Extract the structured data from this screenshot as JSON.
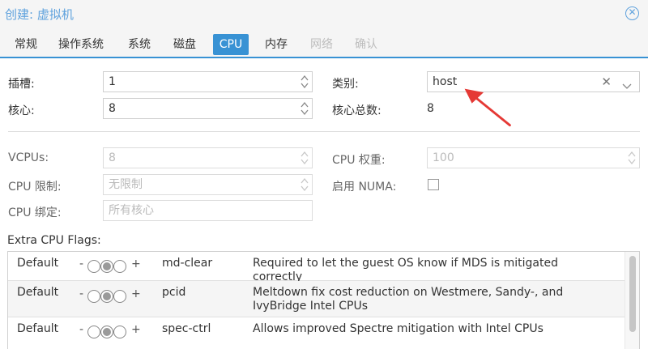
{
  "window": {
    "title": "创建: 虚拟机"
  },
  "tabs": [
    {
      "label": "常规",
      "state": "normal"
    },
    {
      "label": "操作系统",
      "state": "normal"
    },
    {
      "label": "系统",
      "state": "normal"
    },
    {
      "label": "磁盘",
      "state": "normal"
    },
    {
      "label": "CPU",
      "state": "active"
    },
    {
      "label": "内存",
      "state": "normal"
    },
    {
      "label": "网络",
      "state": "disabled"
    },
    {
      "label": "确认",
      "state": "disabled"
    }
  ],
  "form": {
    "sockets": {
      "label": "插槽:",
      "value": "1"
    },
    "cores": {
      "label": "核心:",
      "value": "8"
    },
    "type": {
      "label": "类别:",
      "value": "host",
      "clear_glyph": "✕"
    },
    "total_cores": {
      "label": "核心总数:",
      "value": "8"
    },
    "vcpus": {
      "label": "VCPUs:",
      "value": "8"
    },
    "cpu_weight": {
      "label": "CPU 权重:",
      "value": "100"
    },
    "cpu_limit": {
      "label": "CPU 限制:",
      "placeholder": "无限制"
    },
    "numa": {
      "label": "启用 NUMA:",
      "checked": false
    },
    "cpu_affinity": {
      "label": "CPU 绑定:",
      "placeholder": "所有核心"
    }
  },
  "flags": {
    "label": "Extra CPU Flags:",
    "rows": [
      {
        "state": "Default",
        "minus": "-",
        "plus": "+",
        "name": "md-clear",
        "description": "Required to let the guest OS know if MDS is mitigated correctly"
      },
      {
        "state": "Default",
        "minus": "-",
        "plus": "+",
        "name": "pcid",
        "description": "Meltdown fix cost reduction on Westmere, Sandy-, and IvyBridge Intel CPUs"
      },
      {
        "state": "Default",
        "minus": "-",
        "plus": "+",
        "name": "spec-ctrl",
        "description": "Allows improved Spectre mitigation with Intel CPUs"
      }
    ]
  },
  "colors": {
    "accent": "#3892d4",
    "title": "#5fa2dd",
    "arrow": "#e53935"
  },
  "icons": {
    "close": "close-circle-icon",
    "spinner": "spinner-arrows-icon",
    "dropdown": "chevron-down-icon",
    "annotation": "red-arrow-icon"
  }
}
